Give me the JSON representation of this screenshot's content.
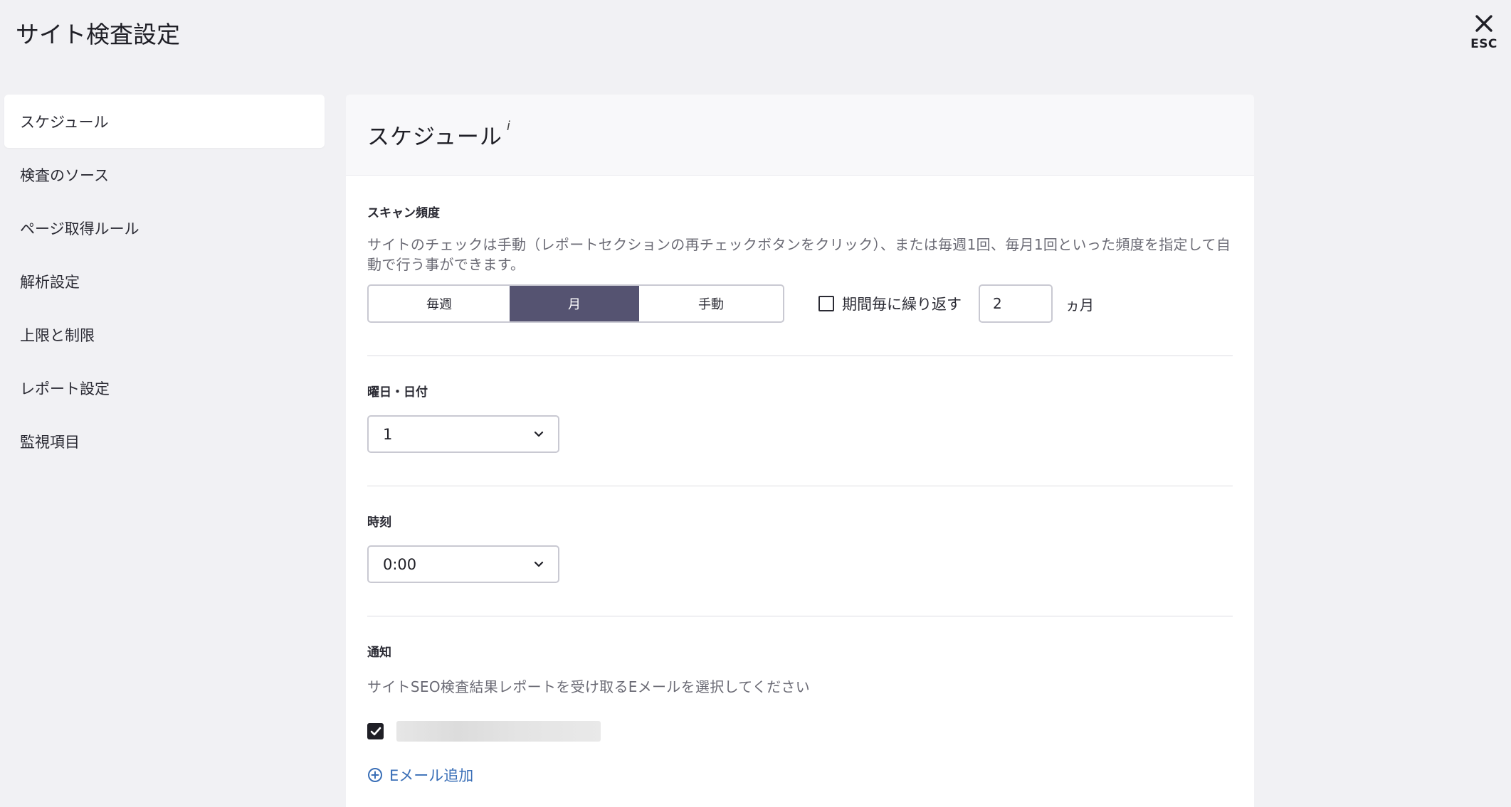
{
  "header": {
    "title": "サイト検査設定",
    "close_label": "ESC"
  },
  "sidebar": {
    "items": [
      {
        "label": "スケジュール",
        "active": true
      },
      {
        "label": "検査のソース",
        "active": false
      },
      {
        "label": "ページ取得ルール",
        "active": false
      },
      {
        "label": "解析設定",
        "active": false
      },
      {
        "label": "上限と制限",
        "active": false
      },
      {
        "label": "レポート設定",
        "active": false
      },
      {
        "label": "監視項目",
        "active": false
      }
    ]
  },
  "panel": {
    "title": "スケジュール",
    "info_marker": "i",
    "scan_frequency": {
      "label": "スキャン頻度",
      "description": "サイトのチェックは手動（レポートセクションの再チェックボタンをクリック）、または毎週1回、毎月1回といった頻度を指定して自動で行う事ができます。",
      "options": [
        "毎週",
        "月",
        "手動"
      ],
      "selected": "月",
      "repeat_label": "期間毎に繰り返す",
      "repeat_checked": false,
      "repeat_value": "2",
      "repeat_unit": "ヵ月"
    },
    "day": {
      "label": "曜日・日付",
      "value": "1"
    },
    "time": {
      "label": "時刻",
      "value": "0:00"
    },
    "notification": {
      "label": "通知",
      "description": "サイトSEO検査結果レポートを受け取るEメールを選択してください",
      "email_checked": true,
      "add_email_label": "Eメール追加"
    }
  },
  "colors": {
    "background": "#f1f1f4",
    "segment_active": "#555371",
    "link": "#3a6fb7"
  },
  "icons": {
    "close": "close-icon",
    "chevron": "chevron-down-icon",
    "add": "plus-circle-icon",
    "check": "check-icon"
  }
}
